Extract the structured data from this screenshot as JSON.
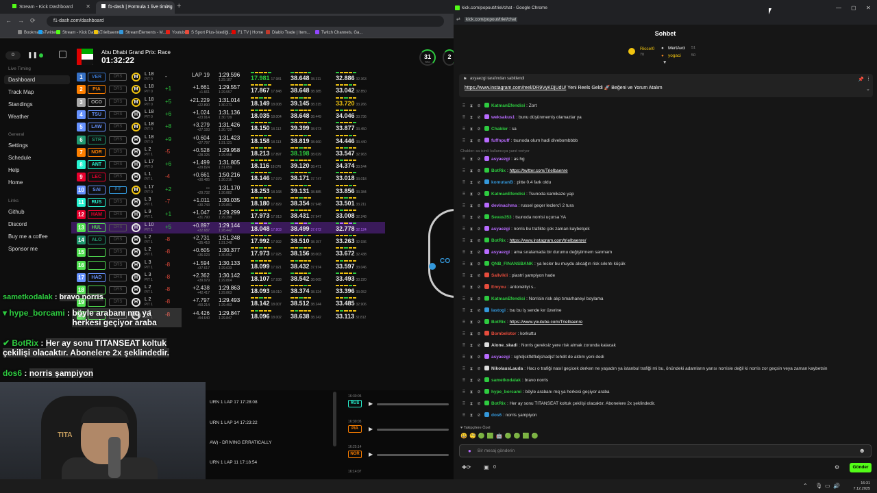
{
  "left_window": {
    "tabs": [
      {
        "label": "Stream - Kick Dashboard"
      },
      {
        "label": "f1-dash | Formula 1 live timing"
      }
    ],
    "url": "f1-dash.com/dashboard",
    "bookmarks": [
      {
        "label": "Bookmarks",
        "color": "#888888"
      },
      {
        "label": "Twitter",
        "color": "#1da1f2"
      },
      {
        "label": "Stream - Kick Dashb...",
        "color": "#53fc18"
      },
      {
        "label": "Trielbaenre",
        "color": "#f1c40f"
      },
      {
        "label": "StreamElements - M...",
        "color": "#3498db"
      },
      {
        "label": "Youtube",
        "color": "#e62117"
      },
      {
        "label": "S Sport Plus-İstediği...",
        "color": "#e74c3c"
      },
      {
        "label": "F1 TV | Home",
        "color": "#e10600"
      },
      {
        "label": "Diablo Trade | Item...",
        "color": "#c0392b"
      },
      {
        "label": "Twitch Channels, Ga...",
        "color": "#9146ff"
      }
    ]
  },
  "sidebar": {
    "counter": "0",
    "sections": [
      {
        "title": "Live Timing",
        "items": [
          "Dashboard",
          "Track Map",
          "Standings",
          "Weather"
        ]
      },
      {
        "title": "General",
        "items": [
          "Settings",
          "Schedule",
          "Help",
          "Home"
        ]
      },
      {
        "title": "Links",
        "items": [
          "Github",
          "Discord",
          "Buy me a coffee",
          "Sponsor me"
        ]
      }
    ]
  },
  "race": {
    "title": "Abu Dhabi Grand Prix: Race",
    "time": "01:32:22",
    "track_temp": "31",
    "track_temp_label": "TRC",
    "air_temp": "2"
  },
  "timing": [
    {
      "pos": "1",
      "tla": "VER",
      "color": "#3671c6",
      "drs": "DRS",
      "tyre": "M",
      "tl": "L 18",
      "pit": "PIT 0",
      "pm": "-",
      "pmc": "w",
      "gap": "LAP 19",
      "gap2": "",
      "lap": "1:29.596",
      "lap2": "1:29.187",
      "s1": "17.981",
      "s1b": "17.981",
      "s1c": "g",
      "s2": "38.648",
      "s2b": "38.311",
      "s2c": "w",
      "s3": "32.886",
      "s3b": "32.363",
      "s3c": "w"
    },
    {
      "pos": "2",
      "tla": "PIA",
      "color": "#ff8000",
      "drs": "DRS",
      "tyre": "M",
      "tl": "L 18",
      "pit": "PIT 0",
      "pm": "+1",
      "pmc": "g",
      "gap": "+1.661",
      "gap2": "+1.661",
      "lap": "1:29.557",
      "lap2": "1:29.557",
      "s1": "17.867",
      "s1b": "17.848",
      "s1c": "w",
      "s2": "38.648",
      "s2b": "38.385",
      "s2c": "w",
      "s3": "33.042",
      "s3b": "32.850",
      "s3c": "w"
    },
    {
      "pos": "3",
      "tla": "OCO",
      "color": "#aaaaaa",
      "drs": "DRS",
      "tyre": "M",
      "tl": "L 18",
      "pit": "PIT 0",
      "pm": "+5",
      "pmc": "g",
      "gap": "+21.229",
      "gap2": "+22.890",
      "lap": "1:31.014",
      "lap2": "1:30.271",
      "s1": "18.149",
      "s1b": "18.008",
      "s1c": "w",
      "s2": "39.145",
      "s2b": "38.315",
      "s2c": "w",
      "s3": "33.720",
      "s3b": "33.266",
      "s3c": "y"
    },
    {
      "pos": "4",
      "tla": "TSU",
      "color": "#6692ff",
      "drs": "DRS",
      "tyre": "H",
      "tl": "L 18",
      "pit": "PIT 0",
      "pm": "+6",
      "pmc": "g",
      "gap": "+1.024",
      "gap2": "+23.914",
      "lap": "1:31.136",
      "lap2": "1:30.729",
      "s1": "18.035",
      "s1b": "18.004",
      "s1c": "w",
      "s2": "38.648",
      "s2b": "38.449",
      "s2c": "w",
      "s3": "34.046",
      "s3b": "33.736",
      "s3c": "w"
    },
    {
      "pos": "5",
      "tla": "LAW",
      "color": "#6692ff",
      "drs": "DRS",
      "tyre": "M",
      "tl": "L 18",
      "pit": "PIT 0",
      "pm": "+8",
      "pmc": "g",
      "gap": "+3.279",
      "gap2": "+27.193",
      "lap": "1:31.426",
      "lap2": "1:30.729",
      "s1": "18.150",
      "s1b": "18.112",
      "s1c": "w",
      "s2": "39.399",
      "s2b": "38.973",
      "s2c": "w",
      "s3": "33.877",
      "s3b": "33.450",
      "s3c": "w"
    },
    {
      "pos": "6",
      "tla": "STR",
      "color": "#229971",
      "drs": "DRS",
      "tyre": "H",
      "tl": "L 18",
      "pit": "PIT 0",
      "pm": "+9",
      "pmc": "g",
      "gap": "+0.604",
      "gap2": "+27.797",
      "lap": "1:31.423",
      "lap2": "1:31.121",
      "s1": "18.158",
      "s1b": "18.113",
      "s1c": "w",
      "s2": "38.819",
      "s2b": "38.660",
      "s2c": "w",
      "s3": "34.446",
      "s3b": "33.440",
      "s3c": "w"
    },
    {
      "pos": "7",
      "tla": "NOR",
      "color": "#ff8000",
      "drs": "DRS",
      "tyre": "H",
      "tl": "L 2",
      "pit": "PIT 1",
      "pm": "-5",
      "pmc": "r",
      "gap": "+0.528",
      "gap2": "+28.325",
      "lap": "1:29.958",
      "lap2": "1:29.958",
      "s1": "18.213",
      "s1b": "17.897",
      "s1c": "w",
      "s2": "38.198",
      "s2b": "38.029",
      "s2c": "g",
      "s3": "33.547",
      "s3b": "32.963",
      "s3c": "w"
    },
    {
      "pos": "8",
      "tla": "ANT",
      "color": "#27f4d2",
      "drs": "DRS",
      "tyre": "H",
      "tl": "L 17",
      "pit": "PIT 0",
      "pm": "+6",
      "pmc": "g",
      "gap": "+1.499",
      "gap2": "+29.824",
      "lap": "1:31.805",
      "lap2": "1:31.059",
      "s1": "18.116",
      "s1b": "18.076",
      "s1c": "w",
      "s2": "39.120",
      "s2b": "38.471",
      "s2c": "w",
      "s3": "34.374",
      "s3b": "33.544",
      "s3c": "w"
    },
    {
      "pos": "9",
      "tla": "LEC",
      "color": "#e8002d",
      "drs": "DRS",
      "tyre": "H",
      "tl": "L 1",
      "pit": "PIT 1",
      "pm": "-4",
      "pmc": "r",
      "gap": "+0.661",
      "gap2": "+30.485",
      "lap": "1:50.216",
      "lap2": "1:30.216",
      "s1": "18.146",
      "s1b": "17.979",
      "s1c": "w",
      "s2": "38.171",
      "s2b": "37.747",
      "s2c": "w",
      "s3": "33.018",
      "s3b": "33.018",
      "s3c": "w"
    },
    {
      "pos": "10",
      "tla": "SAI",
      "color": "#6692ff",
      "drs": "PIT",
      "tyre": "M",
      "tl": "L 17",
      "pit": "PIT 0",
      "pm": "+2",
      "pmc": "g",
      "gap": "--",
      "gap2": "+29.732",
      "lap": "1:31.170",
      "lap2": "1:30.882",
      "s1": "18.253",
      "s1b": "18.168",
      "s1c": "w",
      "s2": "39.131",
      "s2b": "38.885",
      "s2c": "w",
      "s3": "33.856",
      "s3b": "33.384",
      "s3c": "w"
    },
    {
      "pos": "11",
      "tla": "RUS",
      "color": "#27f4d2",
      "drs": "DRS",
      "tyre": "H",
      "tl": "L 3",
      "pit": "PIT 1",
      "pm": "-7",
      "pmc": "r",
      "gap": "+1.011",
      "gap2": "+30.743",
      "lap": "1:30.035",
      "lap2": "1:29.891",
      "s1": "18.180",
      "s1b": "17.829",
      "s1c": "w",
      "s2": "38.354",
      "s2b": "37.948",
      "s2c": "w",
      "s3": "33.501",
      "s3b": "33.211",
      "s3c": "w"
    },
    {
      "pos": "12",
      "tla": "HAM",
      "color": "#e8002d",
      "drs": "DRS",
      "tyre": "H",
      "tl": "L 9",
      "pit": "PIT 1",
      "pm": "+1",
      "pmc": "g",
      "gap": "+1.047",
      "gap2": "+31.790",
      "lap": "1:29.299",
      "lap2": "1:29.299",
      "s1": "17.973",
      "s1b": "17.913",
      "s1c": "w",
      "s2": "38.431",
      "s2b": "37.947",
      "s2c": "w",
      "s3": "33.008",
      "s3b": "32.248",
      "s3c": "w"
    },
    {
      "pos": "13",
      "tla": "HUL",
      "color": "#52e252",
      "drs": "DRS",
      "tyre": "H",
      "tl": "L 10",
      "pit": "PIT 1",
      "pm": "+5",
      "pmc": "g",
      "gap": "+0.897",
      "gap2": "+32.687",
      "lap": "1:29.144",
      "lap2": "1:28.442",
      "s1": "18.048",
      "s1b": "17.803",
      "s1c": "w",
      "s2": "38.499",
      "s2b": "37.672",
      "s2c": "w",
      "s3": "32.778",
      "s3b": "32.124",
      "s3c": "w",
      "hl": true
    },
    {
      "pos": "14",
      "tla": "ALO",
      "color": "#229971",
      "drs": "DRS",
      "tyre": "H",
      "tl": "L 2",
      "pit": "PIT 1",
      "pm": "-8",
      "pmc": "r",
      "gap": "+2.731",
      "gap2": "+35.418",
      "lap": "1:51.248",
      "lap2": "1:31.248",
      "s1": "17.992",
      "s1b": "17.992",
      "s1c": "w",
      "s2": "38.510",
      "s2b": "38.157",
      "s2c": "w",
      "s3": "33.263",
      "s3b": "32.936",
      "s3c": "w"
    },
    {
      "pos": "15",
      "tla": "",
      "color": "#52e252",
      "drs": "DRS",
      "tyre": "H",
      "tl": "L 2",
      "pit": "PIT 1",
      "pm": "-8",
      "pmc": "r",
      "gap": "+0.605",
      "gap2": "+36.023",
      "lap": "1:30.377",
      "lap2": "1:30.052",
      "s1": "17.973",
      "s1b": "17.925",
      "s1c": "w",
      "s2": "38.156",
      "s2b": "38.003",
      "s2c": "w",
      "s3": "33.672",
      "s3b": "32.438",
      "s3c": "w"
    },
    {
      "pos": "16",
      "tla": "",
      "color": "#52e252",
      "drs": "DRS",
      "tyre": "H",
      "tl": "L 3",
      "pit": "PIT 1",
      "pm": "-8",
      "pmc": "r",
      "gap": "+1.594",
      "gap2": "+37.617",
      "lap": "1:30.133",
      "lap2": "1:29.633",
      "s1": "18.099",
      "s1b": "17.921",
      "s1c": "w",
      "s2": "38.432",
      "s2b": "37.974",
      "s2c": "w",
      "s3": "33.597",
      "s3b": "33.046",
      "s3c": "w"
    },
    {
      "pos": "17",
      "tla": "HAD",
      "color": "#6692ff",
      "drs": "DRS",
      "tyre": "H",
      "tl": "L 3",
      "pit": "PIT 1",
      "pm": "-8",
      "pmc": "r",
      "gap": "+2.362",
      "gap2": "+39.979",
      "lap": "1:30.142",
      "lap2": "1:29.804",
      "s1": "18.107",
      "s1b": "17.938",
      "s1c": "w",
      "s2": "38.542",
      "s2b": "38.065",
      "s2c": "w",
      "s3": "33.493",
      "s3b": "33.220",
      "s3c": "w"
    },
    {
      "pos": "18",
      "tla": "",
      "color": "#52e252",
      "drs": "DRS",
      "tyre": "H",
      "tl": "L 2",
      "pit": "PIT 1",
      "pm": "-8",
      "pmc": "r",
      "gap": "+2.438",
      "gap2": "+42.417",
      "lap": "1:29.863",
      "lap2": "1:29.863",
      "s1": "18.093",
      "s1b": "18.010",
      "s1c": "w",
      "s2": "38.374",
      "s2b": "38.324",
      "s2c": "w",
      "s3": "33.396",
      "s3b": "33.052",
      "s3c": "w"
    },
    {
      "pos": "19",
      "tla": "",
      "color": "#52e252",
      "drs": "DRS",
      "tyre": "H",
      "tl": "L 2",
      "pit": "PIT 1",
      "pm": "-8",
      "pmc": "r",
      "gap": "+7.797",
      "gap2": "+50.214",
      "lap": "1:29.493",
      "lap2": "1:29.493",
      "s1": "18.142",
      "s1b": "18.007",
      "s1c": "w",
      "s2": "38.512",
      "s2b": "38.244",
      "s2c": "w",
      "s3": "33.485",
      "s3b": "32.906",
      "s3c": "w"
    },
    {
      "pos": "20",
      "tla": "",
      "color": "#52e252",
      "drs": "DRS",
      "tyre": "H",
      "tl": "L 2",
      "pit": "PIT 1",
      "pm": "-8",
      "pmc": "r",
      "gap": "+4.426",
      "gap2": "+54.640",
      "lap": "1:29.847",
      "lap2": "1:29.847",
      "s1": "18.096",
      "s1b": "18.002",
      "s1c": "w",
      "s2": "38.638",
      "s2b": "38.242",
      "s2c": "w",
      "s3": "33.113",
      "s3b": "32.812",
      "s3c": "w"
    }
  ],
  "track": {
    "label": "CO"
  },
  "overlay_chat": [
    {
      "user": "sametkodalak",
      "text": "bravo norris"
    },
    {
      "user": "hype_borcami",
      "text": "böyle arabanı mq ya herkesi geçiyor araba"
    },
    {
      "user": "BotRix",
      "text": "Her ay sonu TITANSEAT koltuk çekilişi olacaktır. Abonelere 2x şeklindedir."
    },
    {
      "user": "dos6",
      "text": "norris şampiyon"
    }
  ],
  "cam": {
    "logo": "TITA"
  },
  "race_control": [
    "URN 1 LAP 17 17:28:08",
    "URN 1 LAP 14 17:23:22",
    "AW) - DRIVING ERRATICALLY",
    "URN 1 LAP 11 17:18:54"
  ],
  "radio_clips": [
    {
      "time": "16:30:05",
      "driver": "RUS",
      "color": "#27f4d2"
    },
    {
      "time": "16:30:05",
      "driver": "PIA",
      "color": "#ff8000"
    },
    {
      "time": "16:25:14",
      "driver": "NOR",
      "color": "#ff8000"
    }
  ],
  "radio_next_time": "16:14:07",
  "right_window": {
    "title": "kick.com/popout/triel/chat - Google Chrome",
    "url": "kick.com/popout/triel/chat",
    "header": "Sohbet",
    "gifters": [
      {
        "name": "Riccel0",
        "count": "70",
        "color": "#f1c40f"
      },
      {
        "name": "MertAvci",
        "count": "51",
        "color": "#ffffff"
      },
      {
        "name": "yogaci",
        "count": "50",
        "color": "#f1c40f"
      }
    ],
    "pinned": {
      "by": "asyaezgi tarafından sabitlendi",
      "link": "https://www.instagram.com/reel/DR9VyKDjUdU/",
      "text": "Yeni Reels Geldi 🚀 Beğeni ve Yorum Atalım"
    },
    "messages": [
      {
        "user": "KatmanEfendisi",
        "color": "#2ecc40",
        "text": "Zort"
      },
      {
        "user": "weksakus1",
        "color": "#b86bff",
        "text": "bunu düşünmemiş olamazlar ya"
      },
      {
        "user": "Chabler",
        "color": "#2ecc40",
        "text": "sa"
      },
      {
        "user": "fuffnpuff",
        "color": "#b86bff",
        "text": "tsunoda olum hadi divebombbbb"
      },
      {
        "sys": true,
        "text": "Chabler: sa isimli kullanıcıya yanıt veriyor"
      },
      {
        "user": "asyaezgi",
        "color": "#b86bff",
        "text": "as hg"
      },
      {
        "user": "BotRix",
        "color": "#2ecc40",
        "link": "https://twitter.com/Trielbaenre"
      },
      {
        "user": "komutanB",
        "color": "#3498db",
        "text": "pitte 0.4 fark oldu"
      },
      {
        "user": "KatmanEfendisi",
        "color": "#2ecc40",
        "text": "Tsunoda kamikaze yap"
      },
      {
        "user": "devinachma",
        "color": "#b86bff",
        "text": "russel geçer leclerc'i 2 tura"
      },
      {
        "user": "Sevas353",
        "color": "#2ecc40",
        "text": "tsunoda norrisi uçursa YA"
      },
      {
        "user": "asyaezgi",
        "color": "#b86bff",
        "text": "norris bu trafikte çok zaman kaybetçek"
      },
      {
        "user": "BotRix",
        "color": "#2ecc40",
        "link": "https://www.instagram.com/trielbaenre/"
      },
      {
        "user": "asyaezgi",
        "color": "#b86bff",
        "text": "ama sıralamada bir durumu değiştirmem sanmam"
      },
      {
        "user": "QNB_FINANSBANK",
        "color": "#2ecc40",
        "text": "ya lecler bu muydu alıcağın risk sıkıntı küçük"
      },
      {
        "user": "Sallvikli",
        "color": "#e74c3c",
        "text": "piastri şampiyon hade"
      },
      {
        "user": "Emyou",
        "color": "#e74c3c",
        "text": "antonelliyi s.."
      },
      {
        "user": "KatmanEfendisi",
        "color": "#2ecc40",
        "text": "Norrisin risk alıp tımarhaneyi boylama"
      },
      {
        "user": "lastogi",
        "color": "#3498db",
        "text": "tsu bu iş sende kır üzerine"
      },
      {
        "user": "BotRix",
        "color": "#2ecc40",
        "link": "https://www.youtube.com/Trielbaenre"
      },
      {
        "user": "Bombelotor",
        "color": "#e74c3c",
        "text": "korkuttu"
      },
      {
        "user": "Alone_skadi",
        "color": "#dddddd",
        "text": "Norris gereksiz yere risk almak zorunda kalacak"
      },
      {
        "user": "asyaezgi",
        "color": "#b86bff",
        "text": "sghdjskfldfkdjshadjsf tehdit de aldım yeni dedi"
      },
      {
        "user": "NikolausLauda",
        "color": "#dddddd",
        "text": "Hacı o trafiği nasıl geçicek derken ne yaşadın ya istanbul trafiği mi bu, önündeki adamların yarısı norrisle değil ki norris zor geçsin veya zaman kaybetsin"
      },
      {
        "user": "sametkodalak",
        "color": "#2ecc40",
        "text": "bravo norris"
      },
      {
        "user": "hype_borcami",
        "color": "#2ecc40",
        "text": "böyle arabanı mq ya herkesi geçiyor araba"
      },
      {
        "user": "BotRix",
        "color": "#2ecc40",
        "text": "Her ay sonu TITANSEAT koltuk çekilişi olacaktır. Abonelere 2x şeklindedir."
      },
      {
        "user": "dos6",
        "color": "#3498db",
        "text": "norris şampiyon"
      }
    ],
    "followers_label": "Takipçilere Özel",
    "input_placeholder": "Bir mesaj gönderin",
    "count": "0",
    "send_label": "Gönder"
  },
  "taskbar": {
    "time": "16:31",
    "date": "7.12.2025"
  }
}
